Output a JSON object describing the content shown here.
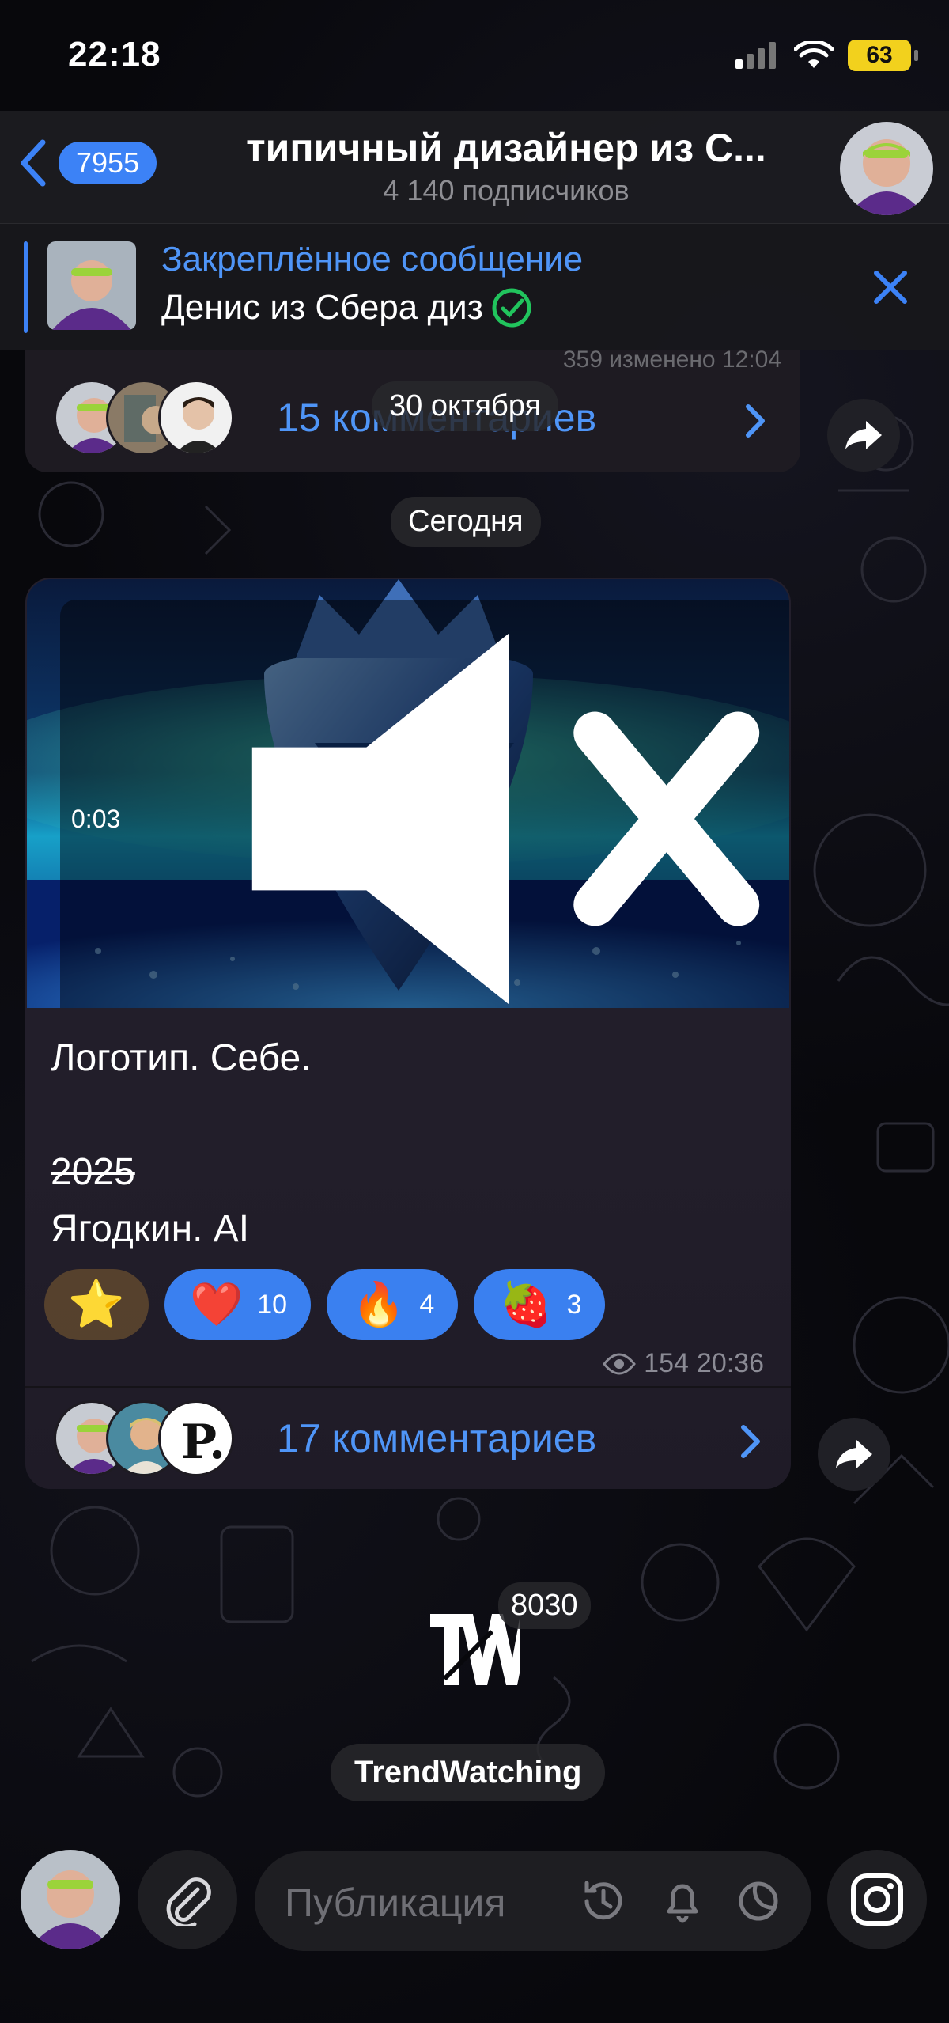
{
  "status_bar": {
    "time": "22:18",
    "battery": "63"
  },
  "header": {
    "back_count": "7955",
    "title": "типичный дизайнер из С...",
    "subtitle": "4 140 подписчиков"
  },
  "pinned": {
    "title": "Закреплённое сообщение",
    "text": "Денис из Сбера диз"
  },
  "prev_message": {
    "meta": "359 изменено 12:04",
    "comments": "15 комментариев",
    "date_overlay": "30 октября"
  },
  "date_today": "Сегодня",
  "post": {
    "video_time": "0:03",
    "text_line1": "Логотип. Себе.",
    "text_strike": "2025",
    "text_line3": "Ягодкин. AI",
    "reactions": [
      {
        "emoji": "❤️",
        "count": "10"
      },
      {
        "emoji": "🔥",
        "count": "4"
      },
      {
        "emoji": "🍓",
        "count": "3"
      }
    ],
    "star_emoji": "⭐",
    "views": "154",
    "time": "20:36",
    "comments": "17 комментариев"
  },
  "sticker": {
    "count": "8030",
    "name": "TrendWatching"
  },
  "input": {
    "placeholder": "Публикация"
  },
  "icons": [
    "back-chevron-icon",
    "cellular-icon",
    "wifi-icon",
    "close-icon",
    "verified-icon",
    "chevron-right-icon",
    "share-icon",
    "mute-icon",
    "eye-icon",
    "attach-icon",
    "timer-icon",
    "bell-icon",
    "moon-icon",
    "instagram-icon"
  ],
  "colors": {
    "accent": "#3c82f6",
    "link": "#4f95f7",
    "battery": "#f2d11d",
    "bubble": "#231f2c"
  }
}
